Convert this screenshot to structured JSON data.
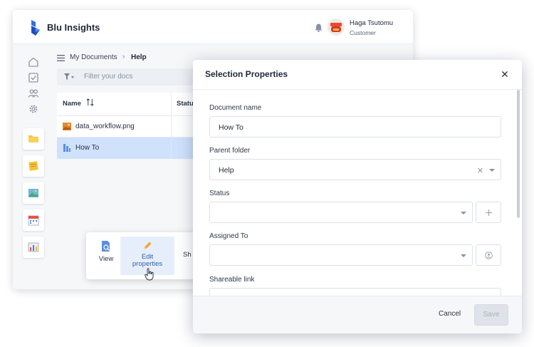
{
  "app": {
    "brand": "Blu Insights",
    "user_name": "Haga Tsutomu",
    "user_role": "Customer"
  },
  "breadcrumb": {
    "root": "My Documents",
    "current": "Help"
  },
  "filter": {
    "placeholder": "Filter your docs"
  },
  "table": {
    "columns": [
      "Name",
      "Status"
    ],
    "rows": [
      {
        "name": "data_workflow.png",
        "icon": "image-file-icon",
        "selected": false
      },
      {
        "name": "How To",
        "icon": "document-icon",
        "selected": true
      }
    ]
  },
  "context_menu": {
    "items": [
      {
        "label": "View",
        "icon": "view-icon"
      },
      {
        "label": "Edit properties",
        "line1": "Edit",
        "line2": "properties",
        "icon": "pencil-icon",
        "active": true
      },
      {
        "label": "Sh",
        "icon": "share-icon"
      }
    ]
  },
  "modal": {
    "title": "Selection Properties",
    "fields": {
      "document_name": {
        "label": "Document name",
        "value": "How To"
      },
      "parent_folder": {
        "label": "Parent folder",
        "value": "Help"
      },
      "status": {
        "label": "Status",
        "value": ""
      },
      "assigned_to": {
        "label": "Assigned To",
        "value": ""
      },
      "shareable_link": {
        "label": "Shareable link",
        "value": ""
      }
    },
    "cancel_label": "Cancel",
    "save_label": "Save"
  },
  "colors": {
    "brand": "#2f6fe0",
    "selected_row": "#cfe1fb",
    "accent_text": "#2f5fa8"
  }
}
